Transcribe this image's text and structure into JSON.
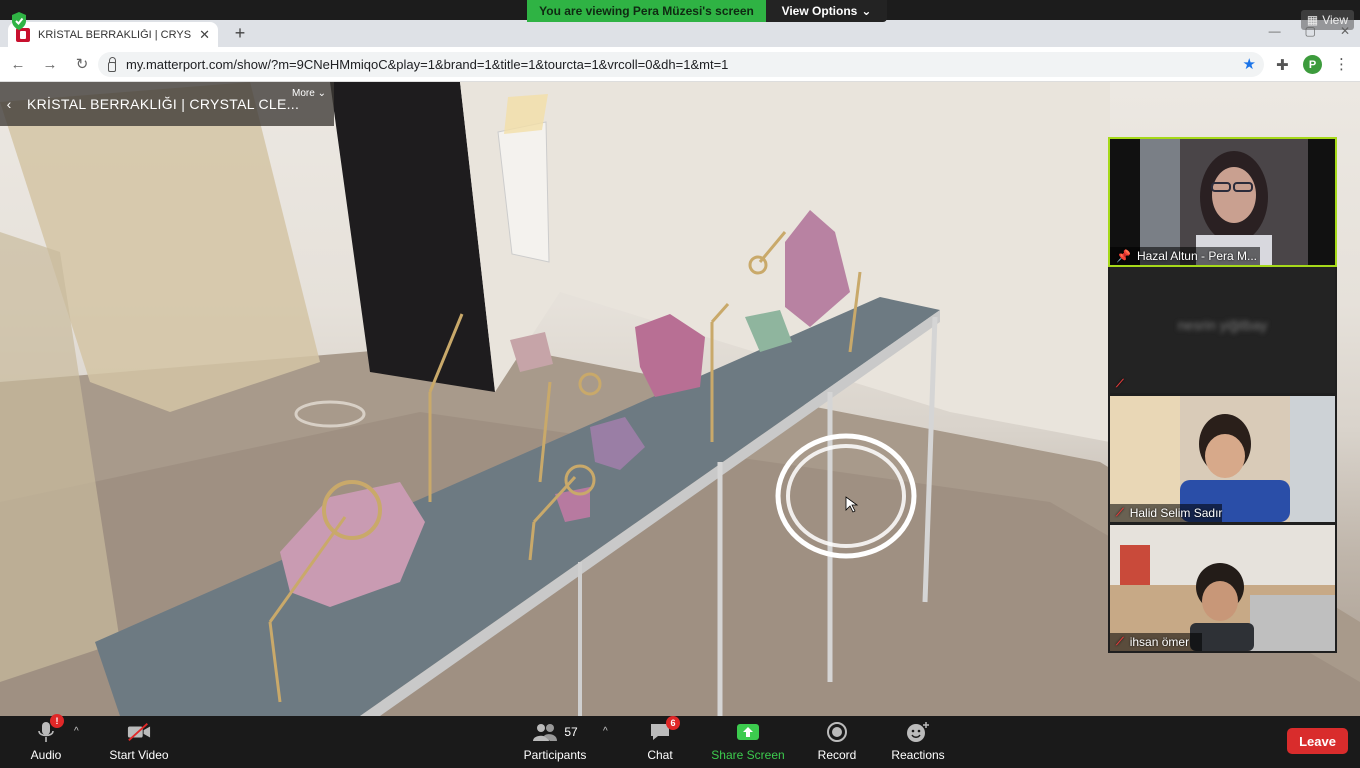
{
  "zoom": {
    "share_banner": "You are viewing Pera Müzesi's screen",
    "view_options": "View Options",
    "view_label": "View",
    "controls": {
      "audio": "Audio",
      "start_video": "Start Video",
      "participants": "Participants",
      "participants_count": "57",
      "chat": "Chat",
      "chat_badge": "6",
      "share_screen": "Share Screen",
      "record": "Record",
      "reactions": "Reactions",
      "leave": "Leave"
    },
    "gallery": [
      {
        "name": "Hazal Altun - Pera M...",
        "pinned": true,
        "muted": false
      },
      {
        "name": "nesrin yiğitbay",
        "video": false,
        "muted": true
      },
      {
        "name": "Halid Selim Sadır",
        "muted": true
      },
      {
        "name": "ihsan ömer",
        "muted": true
      }
    ]
  },
  "browser": {
    "tab_title": "KRİSTAL BERRAKLIĞI | CRYSTAL C",
    "url": "my.matterport.com/show/?m=9CNeHMmiqoC&play=1&brand=1&title=1&tourcta=1&vrcoll=0&dh=1&mt=1",
    "profile_initial": "P"
  },
  "tour": {
    "title": "KRİSTAL BERRAKLIĞI | CRYSTAL CLE...",
    "more": "More"
  },
  "colors": {
    "share_green": "#2fb344",
    "leave_red": "#d92c2c",
    "speaker_outline": "#a6d91a",
    "chrome_blue": "#1a73e8"
  }
}
